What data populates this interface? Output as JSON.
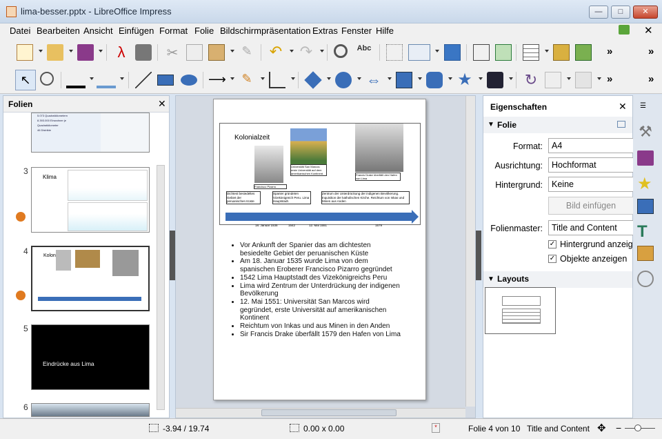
{
  "window": {
    "title": "lima-besser.pptx - LibreOffice Impress"
  },
  "menu": [
    "Datei",
    "Bearbeiten",
    "Ansicht",
    "Einfügen",
    "Format",
    "Folie",
    "Bildschirmpräsentation",
    "Extras",
    "Fenster",
    "Hilfe"
  ],
  "slides_panel": {
    "title": "Folien",
    "numbers": [
      "3",
      "4",
      "5",
      "6"
    ],
    "s2_lines": [
      "5.073 Quadratkilometern",
      "8.393.000 Einwohner je",
      "Quadratkilometer",
      "46 Distrikte"
    ],
    "s3_title": "Klima",
    "s4_title": "Kolonialzeit",
    "s5_text": "Eindrücke aus Lima"
  },
  "slide": {
    "title": "Kolonialzeit",
    "captions": [
      "Francisco Pizarro",
      "Universität San Marcos: erste Universität auf dem amerikanischen Kontinent.",
      "Francis Drake überfällt den Hafen von Lima"
    ],
    "boxes": [
      "Dichtest besiedeltes Gebiet der peruanischen Küste",
      "Spanier gründeten Vizekönigreich Peru. Lima Hauptstadt.",
      "Zentrum der Unterdrückung der indigenen Bevölkerung. Inquisition der katholischen Kirche. Reichtum von Inkas und Minen aus Anden"
    ],
    "timeline": [
      "18. Januar 1535",
      "1542",
      "12. Mai 1551",
      "1579"
    ],
    "bullets": [
      "Vor Ankunft der Spanier das am dichtesten besiedelte Gebiet der peruanischen Küste",
      "Am 18. Januar 1535 wurde Lima von dem spanischen Eroberer Francisco Pizarro gegründet",
      "1542 Lima Hauptstadt des Vizekönigreichs Peru",
      "Lima wird Zentrum der Unterdrückung der indigenen Bevölkerung",
      "12. Mai 1551: Universität San Marcos wird gegründet, erste Universität auf amerikanischen Kontinent",
      "Reichtum von Inkas und aus Minen in den Anden",
      "Sir Francis Drake überfällt 1579 den Hafen von Lima"
    ]
  },
  "sidebar": {
    "title": "Eigenschaften",
    "section_folie": "Folie",
    "format_label": "Format:",
    "format_value": "A4",
    "orient_label": "Ausrichtung:",
    "orient_value": "Hochformat",
    "bg_label": "Hintergrund:",
    "bg_value": "Keine",
    "insert_image": "Bild einfügen",
    "master_label": "Folienmaster:",
    "master_value": "Title and Content",
    "chk_bg": "Hintergrund anzeig",
    "chk_obj": "Objekte anzeigen",
    "section_layouts": "Layouts"
  },
  "status": {
    "position": "-3.94 / 19.74",
    "size": "0.00 x 0.00",
    "slide": "Folie 4 von 10",
    "layout": "Title and Content"
  }
}
